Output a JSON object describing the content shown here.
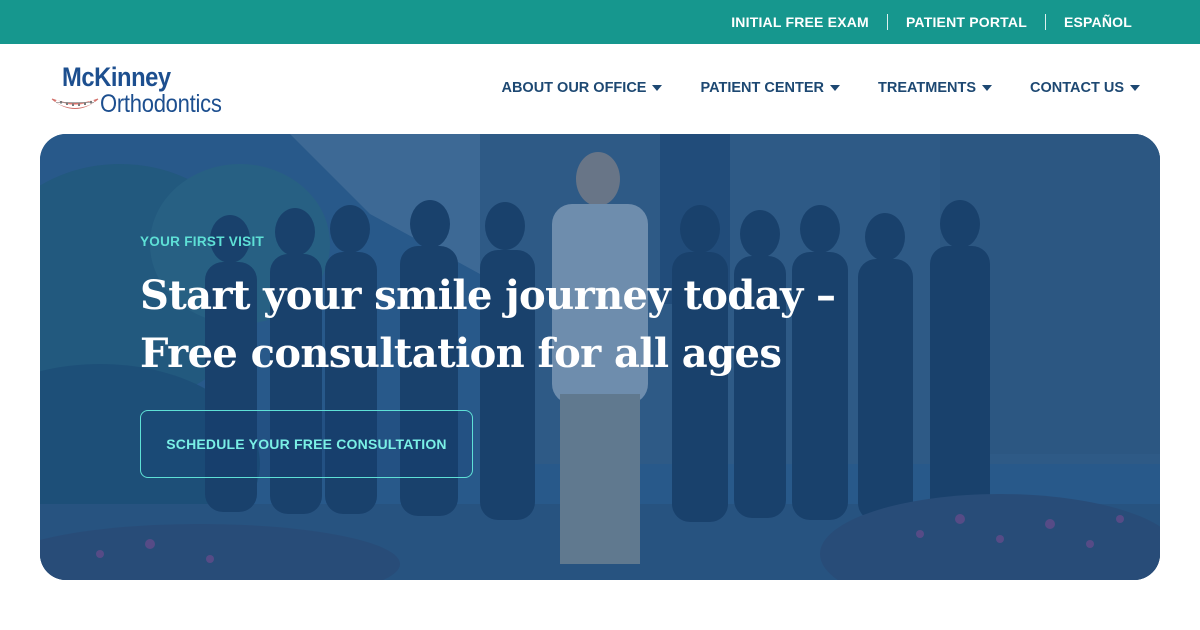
{
  "topbar": {
    "links": [
      "INITIAL FREE EXAM",
      "PATIENT PORTAL",
      "ESPAÑOL"
    ],
    "background": "#16978e"
  },
  "logo": {
    "line1": "McKinney",
    "line2": "Orthodontics",
    "color": "#1d4f8f",
    "icon": "smile-braces-icon"
  },
  "nav": {
    "items": [
      "ABOUT OUR OFFICE",
      "PATIENT CENTER",
      "TREATMENTS",
      "CONTACT US"
    ],
    "icon": "caret-down-icon",
    "color": "#1d4872"
  },
  "hero": {
    "eyebrow": "YOUR FIRST VISIT",
    "headline_line1": "Start your smile journey today –",
    "headline_line2": "Free consultation for all ages",
    "cta_label": "SCHEDULE YOUR FREE CONSULTATION",
    "accent": "#5ee0d6",
    "overlay": "#184a82"
  }
}
